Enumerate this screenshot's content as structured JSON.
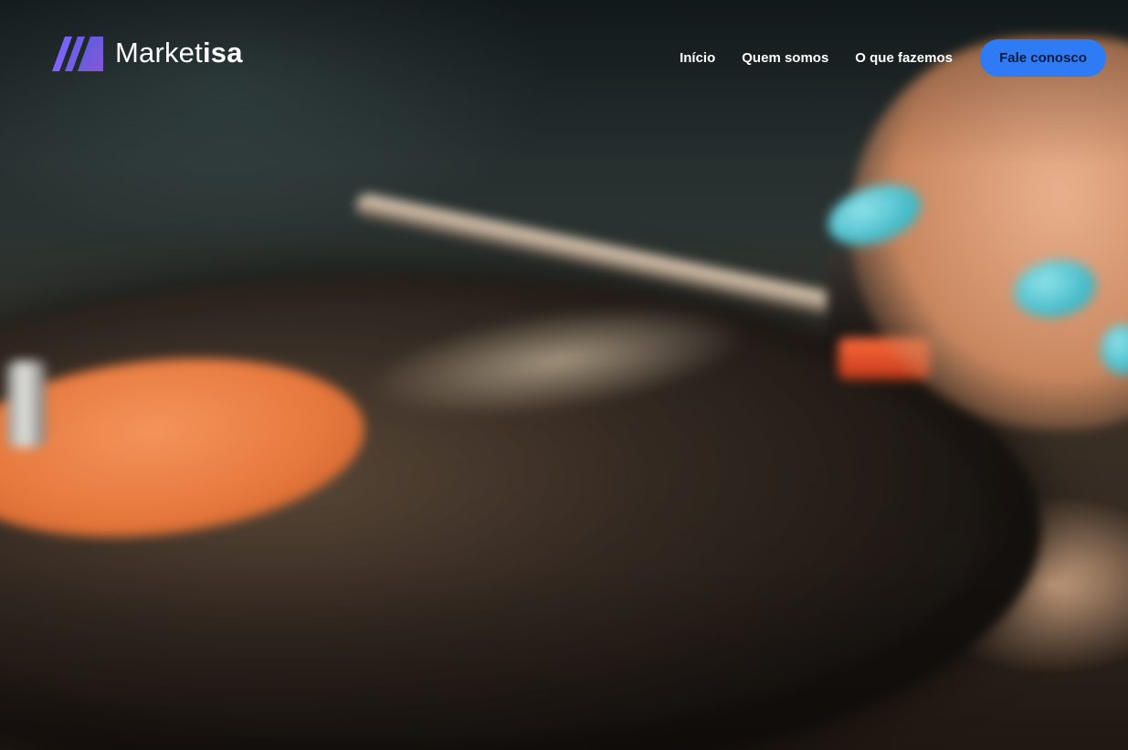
{
  "brand": {
    "name_light": "Market",
    "name_bold": "isa",
    "logo_icon": "marketisa-m-logo-icon",
    "accent_gradient": [
      "#5a6cff",
      "#9b5cf6"
    ]
  },
  "nav": {
    "items": [
      {
        "label": "Início"
      },
      {
        "label": "Quem somos"
      },
      {
        "label": "O que fazemos"
      }
    ]
  },
  "cta": {
    "label": "Fale conosco",
    "color": "#2f7bf5"
  },
  "hero": {
    "background": "blurred-vinyl-record-turntable-photo"
  }
}
